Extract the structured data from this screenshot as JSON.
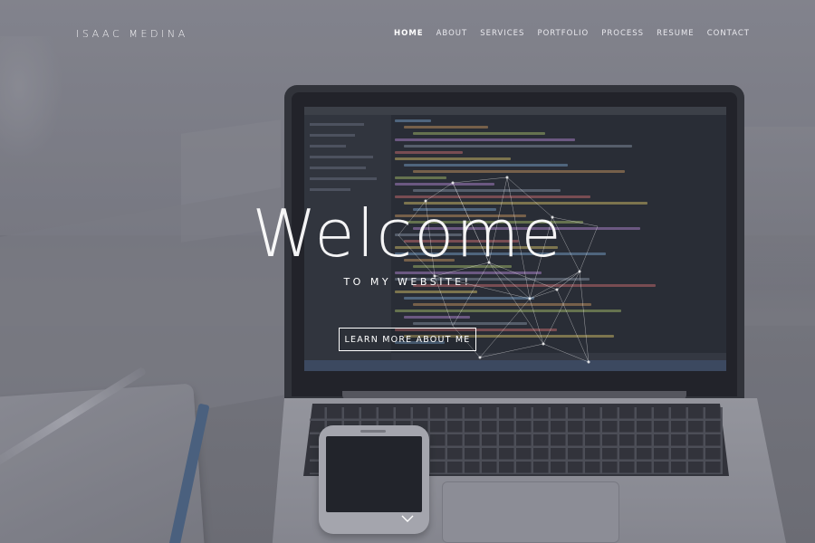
{
  "brand": "ISAAC MEDINA",
  "nav": {
    "items": [
      "HOME",
      "ABOUT",
      "SERVICES",
      "PORTFOLIO",
      "PROCESS",
      "RESUME",
      "CONTACT"
    ],
    "active": "HOME"
  },
  "hero": {
    "title": "Welcome",
    "subtitle": "TO MY WEBSITE!",
    "cta_label": "LEARN MORE ABOUT ME"
  },
  "icons": {
    "scroll_down": "chevron-down-icon"
  },
  "colors": {
    "text": "#ffffff",
    "overlay": "#464852"
  }
}
